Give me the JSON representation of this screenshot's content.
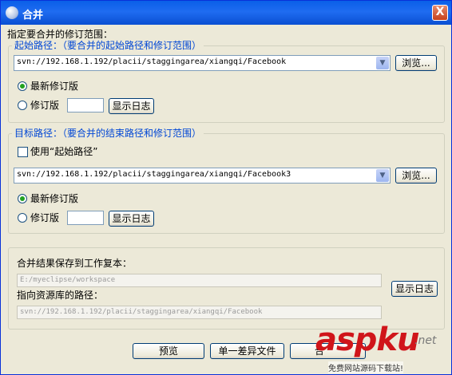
{
  "window": {
    "title": "合并",
    "close_label": "X"
  },
  "instruction": "指定要合并的修订范围：",
  "start_group": {
    "legend": "起始路径：（要合并的起始路径和修订范围）",
    "url": "svn://192.168.1.192/placii/staggingarea/xiangqi/Facebook",
    "browse_label": "浏览...",
    "radio_latest": "最新修订版",
    "radio_revision": "修订版",
    "show_log_label": "显示日志"
  },
  "end_group": {
    "legend": "目标路径：（要合并的结束路径和修订范围）",
    "use_start_label": "使用“起始路径”",
    "url": "svn://192.168.1.192/placii/staggingarea/xiangqi/Facebook3",
    "browse_label": "浏览...",
    "radio_latest": "最新修订版",
    "radio_revision": "修订版",
    "show_log_label": "显示日志"
  },
  "result": {
    "save_label": "合并结果保存到工作复本：",
    "working_copy": "E:/myeclipse/workspace",
    "repo_label": "指向资源库的路径：",
    "repo_path": "svn://192.168.1.192/placii/staggingarea/xiangqi/Facebook",
    "show_log_label": "显示日志"
  },
  "buttons": {
    "preview": "预览",
    "diff": "单一差异文件",
    "merge_partial": "合"
  },
  "watermark": {
    "brand": "aspku",
    "net": ".net",
    "sub": "免费网站源码下载站!"
  },
  "colors": {
    "title_bar": "#0a5fe8",
    "legend_text": "#0046d5",
    "window_bg": "#ece9d8",
    "watermark_red": "#d0151a"
  }
}
